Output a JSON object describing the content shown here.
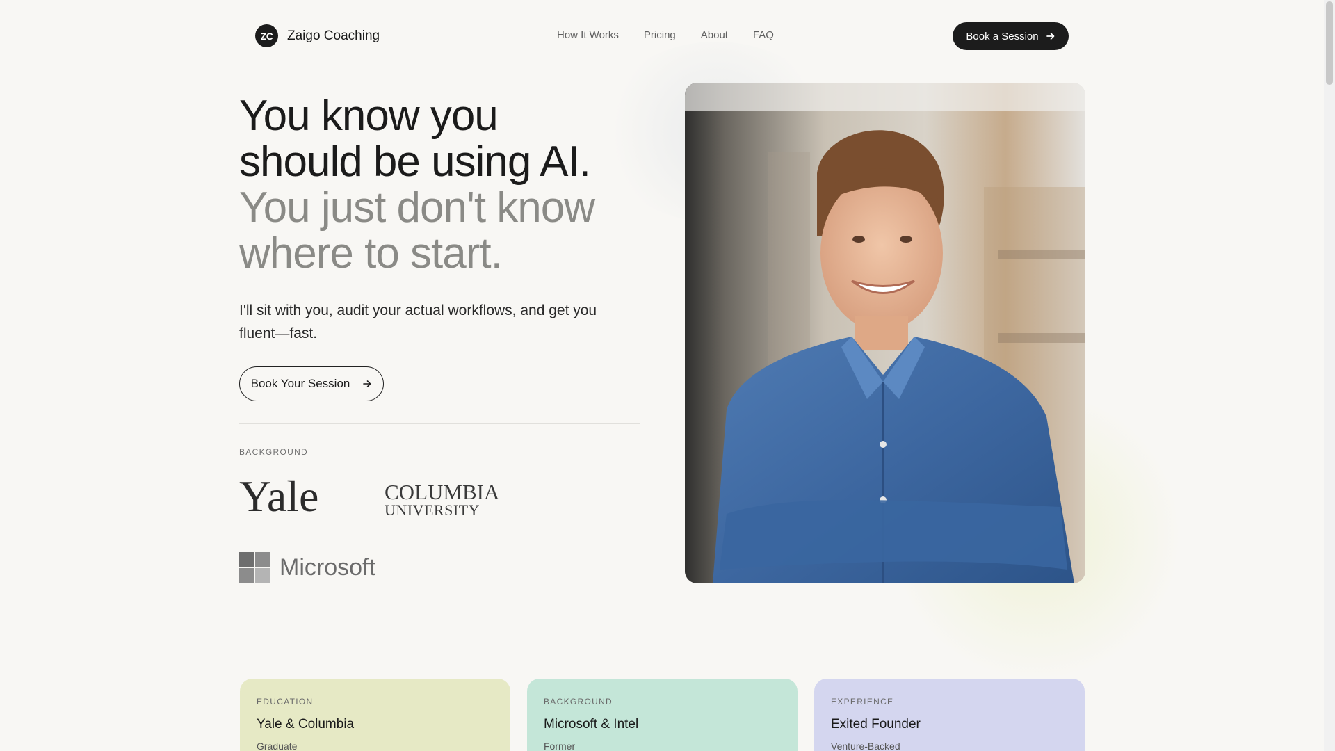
{
  "brand": {
    "mark": "ZC",
    "name": "Zaigo Coaching"
  },
  "nav": {
    "links": [
      "How It Works",
      "Pricing",
      "About",
      "FAQ"
    ],
    "cta_label": "Book a Session"
  },
  "hero": {
    "title_dark": "You know you should be using AI.",
    "title_muted": "You just don't know where to start.",
    "subtitle": "I'll sit with you, audit your actual workflows, and get you fluent—fast.",
    "cta_label": "Book Your Session"
  },
  "credentials": {
    "label": "BACKGROUND",
    "logos": {
      "yale": "Yale",
      "columbia_line1": "COLUMBIA",
      "columbia_line2": "UNIVERSITY",
      "microsoft": "Microsoft"
    }
  },
  "cards": [
    {
      "category": "EDUCATION",
      "title": "Yale & Columbia",
      "subtitle": "Graduate"
    },
    {
      "category": "BACKGROUND",
      "title": "Microsoft & Intel",
      "subtitle": "Former"
    },
    {
      "category": "EXPERIENCE",
      "title": "Exited Founder",
      "subtitle": "Venture-Backed"
    }
  ],
  "colors": {
    "primary": "#1c1c1c",
    "background": "#f8f7f4",
    "muted_text": "#8a8a86",
    "card_education": "#e6e9c5",
    "card_background": "#c4e6d8",
    "card_experience": "#d4d6ef"
  },
  "icons": {
    "cta_arrow": "arrow-right-icon",
    "microsoft_logo": "microsoft-logo-icon"
  }
}
